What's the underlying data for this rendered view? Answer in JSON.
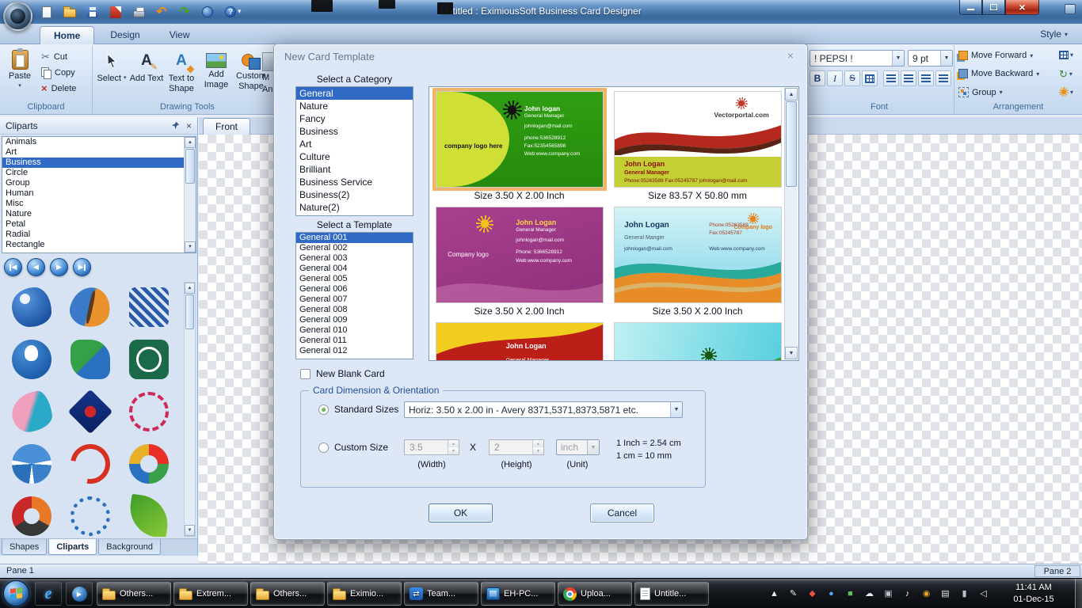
{
  "titlebar": {
    "title": "Untitled : EximiousSoft Business Card Designer"
  },
  "quick_access": [
    "new-document-icon",
    "open-icon",
    "save-icon",
    "export-pdf-icon",
    "print-icon",
    "undo-icon",
    "redo-icon",
    "options-icon",
    "help-icon"
  ],
  "ribbon": {
    "tabs": [
      {
        "label": "Home",
        "active": true
      },
      {
        "label": "Design"
      },
      {
        "label": "View"
      }
    ],
    "style_button": "Style",
    "clipboard": {
      "caption": "Clipboard",
      "paste": "Paste",
      "cut": "Cut",
      "copy": "Copy",
      "delete": "Delete"
    },
    "drawing_tools": {
      "caption": "Drawing Tools",
      "select": "Select",
      "add_text": "Add Text",
      "text_to_shape": "Text to Shape",
      "add_image": "Add Image",
      "custom_shape": "Custom Shape",
      "partial_line1": "M",
      "partial_line2": "An"
    },
    "font": {
      "caption": "Font",
      "family": "! PEPSI !",
      "size": "9 pt",
      "bold": "B",
      "italic": "I"
    },
    "arrangement": {
      "caption": "Arrangement",
      "items": [
        {
          "label": "Move Forward"
        },
        {
          "label": "Move Backward"
        },
        {
          "label": "Group"
        }
      ]
    }
  },
  "cliparts_panel": {
    "title": "Cliparts",
    "categories": [
      {
        "label": "Animals"
      },
      {
        "label": "Art"
      },
      {
        "label": "Business",
        "selected": true
      },
      {
        "label": "Circle"
      },
      {
        "label": "Group"
      },
      {
        "label": "Human"
      },
      {
        "label": "Misc"
      },
      {
        "label": "Nature"
      },
      {
        "label": "Petal"
      },
      {
        "label": "Radial"
      },
      {
        "label": "Rectangle"
      }
    ],
    "thumbnails": [
      {
        "name": "clipart-abstract-figure"
      },
      {
        "name": "clipart-butterfly"
      },
      {
        "name": "clipart-woven-pattern"
      },
      {
        "name": "clipart-globe-figure"
      },
      {
        "name": "clipart-leaf-h-logo"
      },
      {
        "name": "clipart-monogram-badge"
      },
      {
        "name": "clipart-bird"
      },
      {
        "name": "clipart-diamond-emblem"
      },
      {
        "name": "clipart-floral-ring"
      },
      {
        "name": "clipart-volleyball"
      },
      {
        "name": "clipart-swoosh-ring"
      },
      {
        "name": "clipart-ribbon-loop"
      },
      {
        "name": "clipart-people-circle"
      },
      {
        "name": "clipart-circular-arrows"
      },
      {
        "name": "clipart-palm-leaves"
      }
    ],
    "tabs": [
      {
        "label": "Shapes"
      },
      {
        "label": "Cliparts",
        "active": true
      },
      {
        "label": "Background"
      }
    ]
  },
  "canvas": {
    "front_tab": "Front"
  },
  "statusbar": {
    "left": "Pane 1",
    "right": "Pane 2"
  },
  "dialog": {
    "title": "New Card Template",
    "select_category_label": "Select a Category",
    "categories": [
      {
        "label": "General",
        "selected": true
      },
      {
        "label": "Nature"
      },
      {
        "label": "Fancy"
      },
      {
        "label": "Business"
      },
      {
        "label": "Art"
      },
      {
        "label": "Culture"
      },
      {
        "label": "Brilliant"
      },
      {
        "label": "Business Service"
      },
      {
        "label": "Business(2)"
      },
      {
        "label": "Nature(2)"
      }
    ],
    "select_template_label": "Select a Template",
    "templates": [
      {
        "label": "General 001",
        "selected": true
      },
      {
        "label": "General 002"
      },
      {
        "label": "General 003"
      },
      {
        "label": "General 004"
      },
      {
        "label": "General 005"
      },
      {
        "label": "General 006"
      },
      {
        "label": "General 007"
      },
      {
        "label": "General 008"
      },
      {
        "label": "General 009"
      },
      {
        "label": "General 010"
      },
      {
        "label": "General 011"
      },
      {
        "label": "General 012"
      }
    ],
    "cards": {
      "c1": {
        "logo": "company logo here",
        "name": "John logan",
        "role": "General Manager",
        "email": "johnlogan@mail.com",
        "phone": "phone:536528912",
        "fax": "Fax:52354565898",
        "web": "Web:www.company.com",
        "caption": "Size 3.50 X 2.00 Inch"
      },
      "c2": {
        "brand": "Vectorportal.com",
        "name": "John Logan",
        "role": "General Manager",
        "contact": "Phone:05263589  Fax:05245787  johnlogan@mail.com",
        "caption": "Size 83.57 X 50.80 mm"
      },
      "c3": {
        "logo": "Company logo",
        "name": "John Logan",
        "role": "General Manager",
        "email": "johnlogan@mail.com",
        "phone": "Phone: 5366528912",
        "web": "Web:www.company.com",
        "caption": "Size 3.50 X 2.00 Inch"
      },
      "c4": {
        "logo": "Company logo",
        "name": "John Logan",
        "role": "General Manger",
        "phone": "Phone:05263589",
        "fax": "Fax:05245787",
        "email": "johnlogan@mail.com",
        "web": "Web:www.company.com",
        "caption": "Size 3.50 X 2.00 Inch"
      },
      "c5": {
        "name": "John Logan",
        "role": "General Manager"
      }
    },
    "new_blank_card_label": "New Blank Card",
    "dimensions": {
      "caption": "Card Dimension & Orientation",
      "standard_label": "Standard Sizes",
      "standard_value": "Horiz: 3.50 x 2.00 in - Avery 8371,5371,8373,5871 etc.",
      "custom_label": "Custom Size",
      "width": "3.5",
      "times": "X",
      "height": "2",
      "unit": "inch",
      "width_caption": "(Width)",
      "height_caption": "(Height)",
      "unit_caption": "(Unit)",
      "note_line1": "1 Inch = 2.54 cm",
      "note_line2": "1 cm = 10 mm"
    },
    "ok_label": "OK",
    "cancel_label": "Cancel"
  },
  "taskbar": {
    "apps": [
      {
        "label": "Others...",
        "icon": "folder-icon"
      },
      {
        "label": "Extrem...",
        "icon": "folder-icon"
      },
      {
        "label": "Others...",
        "icon": "folder-icon"
      },
      {
        "label": "Eximio...",
        "icon": "folder-icon"
      },
      {
        "label": "Team...",
        "icon": "teamviewer-icon"
      },
      {
        "label": "EH-PC...",
        "icon": "remote-desktop-icon"
      },
      {
        "label": "Uploa...",
        "icon": "chrome-icon"
      },
      {
        "label": "Untitle...",
        "icon": "notepad-icon"
      }
    ],
    "tray": [
      {
        "name": "show-hidden-icons-arrow-icon",
        "glyph": "▲",
        "tone": "light"
      },
      {
        "name": "pen-input-icon",
        "glyph": "✎",
        "tone": "light"
      },
      {
        "name": "security-icon",
        "glyph": "◆",
        "tone": "red"
      },
      {
        "name": "sync-status-icon",
        "glyph": "●",
        "tone": "blue"
      },
      {
        "name": "chat-app-icon",
        "glyph": "■",
        "tone": "green"
      },
      {
        "name": "cloud-app-icon",
        "glyph": "☁",
        "tone": "light"
      },
      {
        "name": "display-settings-icon",
        "glyph": "▣",
        "tone": "gray"
      },
      {
        "name": "media-app-icon",
        "glyph": "♪",
        "tone": "light"
      },
      {
        "name": "updates-icon",
        "glyph": "◉",
        "tone": "amber"
      },
      {
        "name": "network-status-icon",
        "glyph": "▤",
        "tone": "light"
      },
      {
        "name": "battery-icon",
        "glyph": "▮",
        "tone": "gray"
      },
      {
        "name": "volume-icon",
        "glyph": "◁",
        "tone": "light"
      }
    ],
    "clock": {
      "time": "11:41 AM",
      "date": "01-Dec-15"
    }
  }
}
